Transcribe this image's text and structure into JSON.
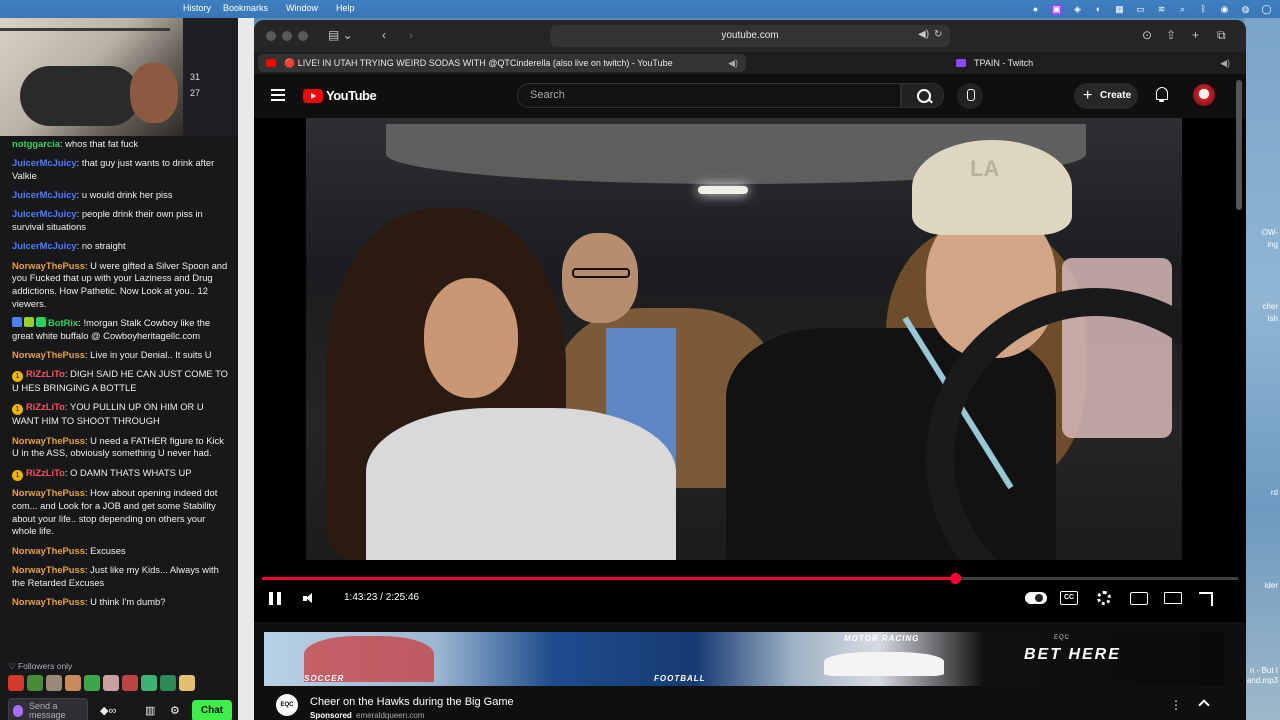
{
  "menubar": {
    "items": [
      "History",
      "Bookmarks",
      "Window",
      "Help"
    ]
  },
  "chat": {
    "side_counts": [
      "31",
      "27"
    ],
    "messages": [
      {
        "user": "notggarcia",
        "text": "whos that fat fuck",
        "color": "green"
      },
      {
        "user": "JuicerMcJuicy",
        "text": "that guy just wants to drink after Valkie",
        "color": "blue"
      },
      {
        "user": "JuicerMcJuicy",
        "text": "u would drink her piss",
        "color": "blue"
      },
      {
        "user": "JuicerMcJuicy",
        "text": "people drink their own piss in survival situations",
        "color": "blue"
      },
      {
        "user": "JuicerMcJuicy",
        "text": "no straight",
        "color": "blue"
      },
      {
        "user": "NorwayThePuss",
        "text": "U were gifted a Silver Spoon and you Fucked that up with your Laziness and Drug addictions. How Pathetic. Now Look at you.. 12 viewers.",
        "color": "orange"
      },
      {
        "user": "BotRix",
        "text": "!morgan Stalk Cowboy like the great white buffalo @ Cowboyheritagellc.com",
        "color": "botrix"
      },
      {
        "user": "NorwayThePuss",
        "text": "Live in your Denial.. It suits U",
        "color": "orange"
      },
      {
        "user": "RiZzLiTo",
        "text": "DIGH SAID HE CAN JUST COME TO U HES BRINGING A BOTTLE",
        "color": "red",
        "badge": "1"
      },
      {
        "user": "RiZzLiTo",
        "text": "YOU PULLIN UP ON HIM OR U WANT HIM TO SHOOT THROUGH",
        "color": "red",
        "badge": "1"
      },
      {
        "user": "NorwayThePuss",
        "text": "U need a FATHER figure to Kick U in the ASS, obviously something U never had.",
        "color": "orange"
      },
      {
        "user": "RiZzLiTo",
        "text": "O DAMN THATS WHATS UP",
        "color": "red",
        "badge": "1"
      },
      {
        "user": "NorwayThePuss",
        "text": "How about opening indeed dot com... and Look for a JOB and get some Stability about your life.. stop depending on others your whole life.",
        "color": "orange"
      },
      {
        "user": "NorwayThePuss",
        "text": "Excuses",
        "color": "orange"
      },
      {
        "user": "NorwayThePuss",
        "text": "Just like my Kids... Always with the Retarded Excuses",
        "color": "orange"
      },
      {
        "user": "NorwayThePuss",
        "text": "U think I'm dumb?",
        "color": "orange"
      }
    ],
    "followers_only": "Followers only",
    "input_placeholder": "Send a message",
    "chat_button": "Chat",
    "emote_colors": [
      "#d33a2c",
      "#4a8a3b",
      "#9a8a7a",
      "#c98b5e",
      "#3aa84a",
      "#c8a0a0",
      "#b44",
      "#3cb371",
      "#2e8b57",
      "#e2c070"
    ]
  },
  "browser": {
    "url": "youtube.com",
    "tabs": [
      {
        "title": "🔴 LIVE! IN UTAH TRYING WEIRD SODAS WITH @QTCinderella (also live on twitch) - YouTube",
        "favicon_color": "#ff0000"
      },
      {
        "title": "TPAIN - Twitch",
        "favicon_color": "#9146ff"
      }
    ]
  },
  "youtube": {
    "logo_text": "YouTube",
    "search_placeholder": "Search",
    "create_label": "Create",
    "current_time": "1:43:23",
    "duration": "2:25:46",
    "time_display": "1:43:23 / 2:25:46",
    "progress_fraction": 0.71,
    "cc_label": "CC"
  },
  "ad": {
    "title": "Cheer on the Hawks during the Big Game",
    "sponsored": "Sponsored",
    "domain": "emeraldqueen.com",
    "banner_labels": [
      "SOCCER",
      "FOOTBALL",
      "MOTOR RACING"
    ],
    "banner_cta": "BET HERE",
    "brand": "EQC",
    "logo_text": "EQC"
  },
  "desktop": {
    "right_labels": [
      "OW-",
      "ing",
      "cher",
      "lsh",
      "rd",
      "lder",
      "n - But I",
      "and.mp3"
    ]
  }
}
